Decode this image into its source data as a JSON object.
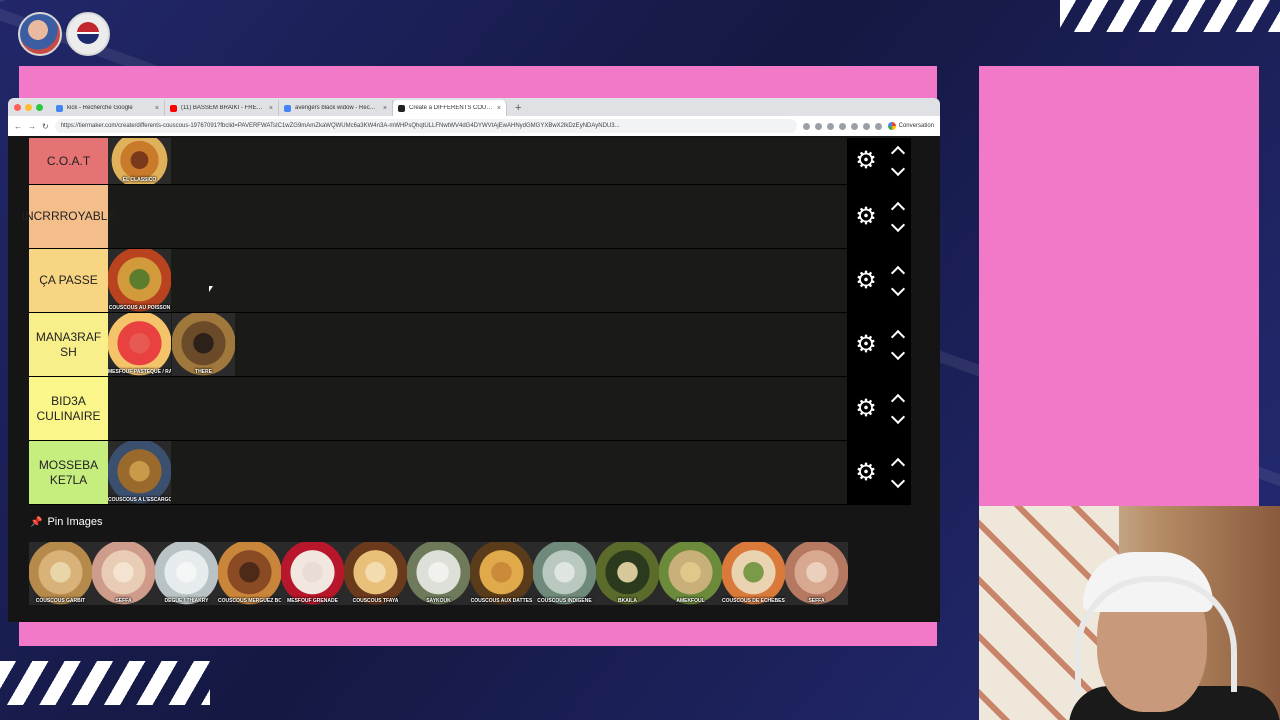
{
  "browser": {
    "tabs": [
      {
        "label": "kick - Recherche Google",
        "fav": "#4285f4",
        "active": false
      },
      {
        "label": "(11) BASSEM BRAIKI - FREESTYLE",
        "fav": "#ff0000",
        "active": false
      },
      {
        "label": "avengers black widow - Recherche",
        "fav": "#4285f4",
        "active": false
      },
      {
        "label": "Create a DIFFERENTS COUSCOUS",
        "fav": "#222222",
        "active": true
      }
    ],
    "url": "https://tiermaker.com/create/differents-couscous-19767091?fbclid=PAVERFWATsIC1wZG9mAmZkaWQWUMc6a3KW4n3A-mWHPsQhqtULLFNwtWV4dG4DYWVtAjEwAHNydGMGYXBwX2lkDzEyNDAyNDU3...",
    "conversation_label": "Conversation"
  },
  "tiers": [
    {
      "label": "C.O.A.T",
      "color": "#e57373",
      "items": [
        {
          "caption": "EL CLASSICO",
          "palette": [
            "#c97a2a",
            "#e0b15b",
            "#7a3a1a"
          ]
        }
      ]
    },
    {
      "label": "INCRRROYABLE",
      "color": "#f4be8a",
      "items": []
    },
    {
      "label": "ÇA PASSE",
      "color": "#f7d582",
      "items": [
        {
          "caption": "COUSCOUS AU POISSON",
          "palette": [
            "#d39a3b",
            "#b8431e",
            "#5d7d2e"
          ]
        }
      ]
    },
    {
      "label": "MANA3RAF SH",
      "color": "#f9ef8a",
      "items": [
        {
          "caption": "MESFOUF PASTEQUE / RAISIN",
          "palette": [
            "#e8413f",
            "#f4c36a",
            "#e65a52"
          ]
        },
        {
          "caption": "THERE",
          "palette": [
            "#6b4a2a",
            "#a0783c",
            "#2b2118"
          ]
        }
      ]
    },
    {
      "label": "BID3A CULINAIRE",
      "color": "#fbf68a",
      "items": []
    },
    {
      "label": "MOSSEBA KE7LA",
      "color": "#c6ee7f",
      "items": [
        {
          "caption": "COUSCOUS A L'ESCARGOT",
          "palette": [
            "#9a6a2c",
            "#3b4f6e",
            "#c99a4a"
          ]
        }
      ]
    }
  ],
  "pin": {
    "title": "Pin Images",
    "items": [
      {
        "caption": "COUSCOUS GARBIT",
        "palette": [
          "#d9b27a",
          "#b58a4a",
          "#e9d6a8"
        ]
      },
      {
        "caption": "SEFFA",
        "palette": [
          "#e8cdb4",
          "#cf9b8a",
          "#f3e3d0"
        ]
      },
      {
        "caption": "DEGUE / THIAKRY",
        "palette": [
          "#e6ecee",
          "#b9c2c4",
          "#f5f7f7"
        ]
      },
      {
        "caption": "COUSCOUS MERGUEZ BOULETTE",
        "palette": [
          "#8a4a24",
          "#c9863a",
          "#4d2a18"
        ]
      },
      {
        "caption": "MESFOUF GRENADE",
        "palette": [
          "#f1e6e0",
          "#b8162a",
          "#e8dcd5"
        ]
      },
      {
        "caption": "COUSCOUS TFAYA",
        "palette": [
          "#e9c07a",
          "#6b3a1c",
          "#f3dcb0"
        ]
      },
      {
        "caption": "SAYKOUK",
        "palette": [
          "#dce0d8",
          "#6e7a5a",
          "#f1f2ee"
        ]
      },
      {
        "caption": "COUSCOUS AUX DATTES",
        "palette": [
          "#e0a94a",
          "#5a3b1a",
          "#c98a3a"
        ]
      },
      {
        "caption": "COUSCOUS INDIGENE",
        "palette": [
          "#b9c9c0",
          "#6f8a7a",
          "#dfe6df"
        ]
      },
      {
        "caption": "BKAILA",
        "palette": [
          "#2b3a1c",
          "#5a6b2a",
          "#d6c89a"
        ]
      },
      {
        "caption": "AMEKFOUL",
        "palette": [
          "#c9b07a",
          "#6b8a3a",
          "#e0c88a"
        ]
      },
      {
        "caption": "COUSCOUS DE ECHEBEST",
        "palette": [
          "#e9d3b0",
          "#d9793a",
          "#7a9a4a"
        ]
      },
      {
        "caption": "SEFFA",
        "palette": [
          "#d8a890",
          "#b57860",
          "#ecd0be"
        ]
      }
    ]
  }
}
